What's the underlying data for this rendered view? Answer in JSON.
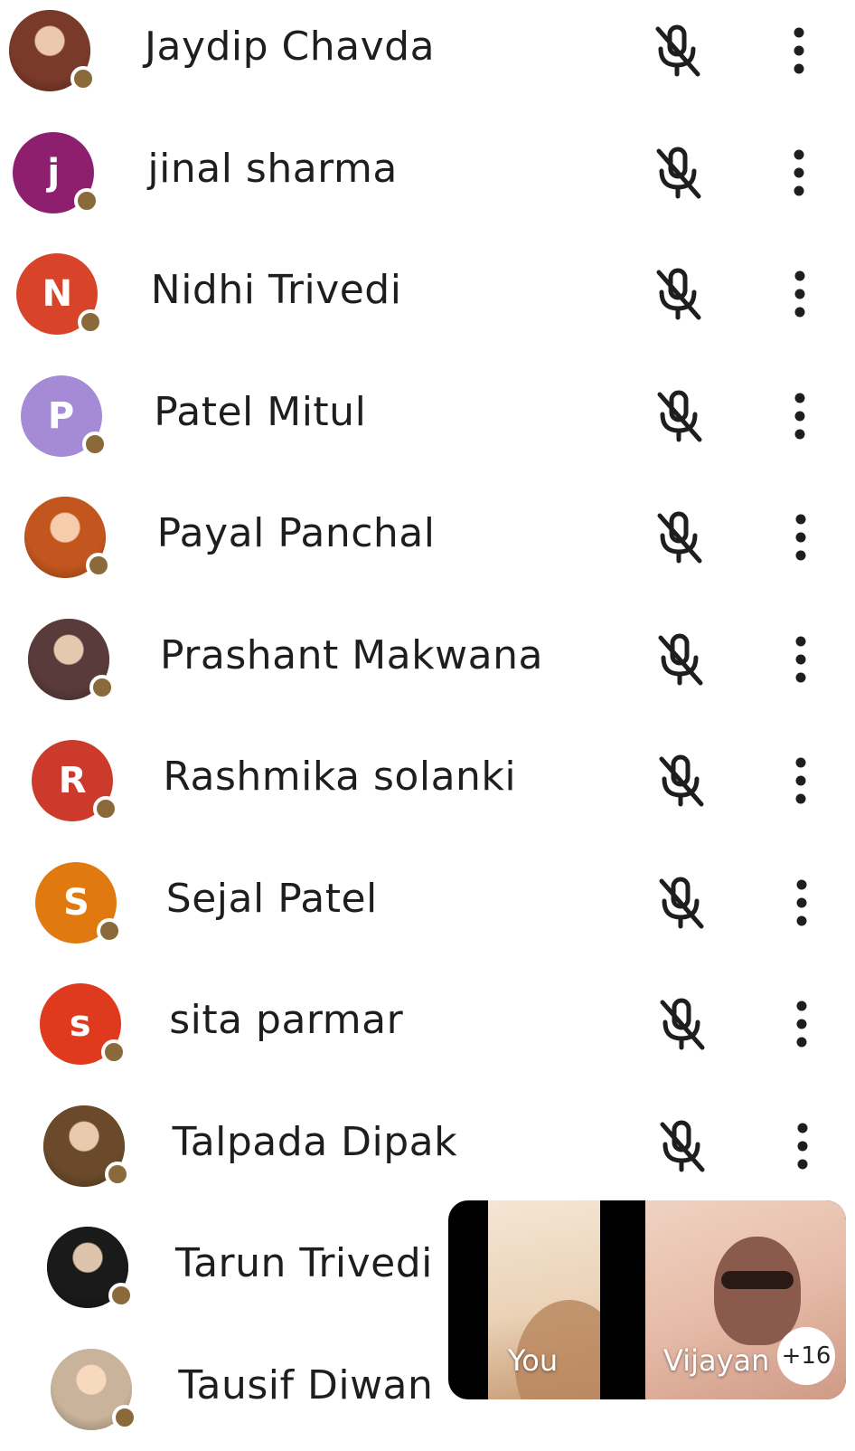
{
  "participants": [
    {
      "name": "Jaydip Chavda",
      "avatar_type": "photo",
      "color": "#7a3a2a"
    },
    {
      "name": "jinal sharma",
      "avatar_type": "initial",
      "initial": "j",
      "color": "#8e1f6f"
    },
    {
      "name": "Nidhi Trivedi",
      "avatar_type": "initial",
      "initial": "N",
      "color": "#d8442a"
    },
    {
      "name": "Patel Mitul",
      "avatar_type": "initial",
      "initial": "P",
      "color": "#a58ad6"
    },
    {
      "name": "Payal Panchal",
      "avatar_type": "photo",
      "color": "#c2561e"
    },
    {
      "name": "Prashant Makwana",
      "avatar_type": "photo",
      "color": "#5a3b3b"
    },
    {
      "name": "Rashmika solanki",
      "avatar_type": "initial",
      "initial": "R",
      "color": "#cc3a2c"
    },
    {
      "name": "Sejal Patel",
      "avatar_type": "initial",
      "initial": "S",
      "color": "#e07a10"
    },
    {
      "name": "sita parmar",
      "avatar_type": "initial",
      "initial": "s",
      "color": "#e03a1e"
    },
    {
      "name": "Talpada Dipak",
      "avatar_type": "photo",
      "color": "#6a4a2a"
    },
    {
      "name": "Tarun Trivedi",
      "avatar_type": "photo",
      "color": "#1a1a1a"
    },
    {
      "name": "Tausif Diwan",
      "avatar_type": "photo",
      "color": "#c9b39a"
    }
  ],
  "self_view": {
    "label": "You"
  },
  "other_view": {
    "label": "Vijayan",
    "more_count": "+16"
  },
  "colors": {
    "status_dot": "#8a6a3a",
    "icon": "#1e1e1e",
    "text": "#1e1e1e"
  },
  "icons": {
    "mic": "mic-off-icon",
    "more": "more-vert-icon"
  }
}
